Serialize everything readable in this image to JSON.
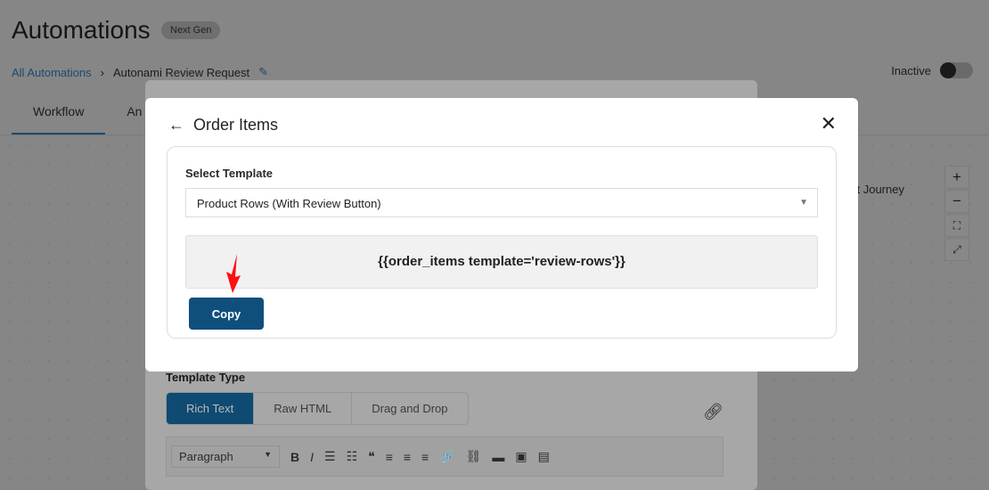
{
  "header": {
    "title": "Automations",
    "badge": "Next Gen",
    "status_label": "Inactive",
    "status_active": false
  },
  "breadcrumb": {
    "root": "All Automations",
    "current": "Autonami Review Request"
  },
  "tabs": [
    {
      "label": "Workflow",
      "active": true
    },
    {
      "label": "An"
    }
  ],
  "canvas": {
    "node_text": "ct Journey",
    "zoom_controls": [
      "plus-icon",
      "minus-icon",
      "fit-icon",
      "expand-icon"
    ]
  },
  "editor": {
    "template_type_label": "Template Type",
    "types": [
      {
        "label": "Rich Text",
        "active": true
      },
      {
        "label": "Raw HTML"
      },
      {
        "label": "Drag and Drop"
      }
    ],
    "format_select": "Paragraph",
    "toolbar_icons": [
      "B",
      "I",
      "☰",
      "☷",
      "❝",
      "≡",
      "≡",
      "≡",
      "🔗",
      "⛓",
      "▬",
      "▣",
      "▤"
    ]
  },
  "modal": {
    "title": "Order Items",
    "select_label": "Select Template",
    "selected_template": "Product Rows (With Review Button)",
    "merge_tag": "{{order_items template='review-rows'}}",
    "copy_label": "Copy"
  },
  "colors": {
    "primary": "#0f4f7c",
    "annotation_arrow": "#ff0000"
  }
}
